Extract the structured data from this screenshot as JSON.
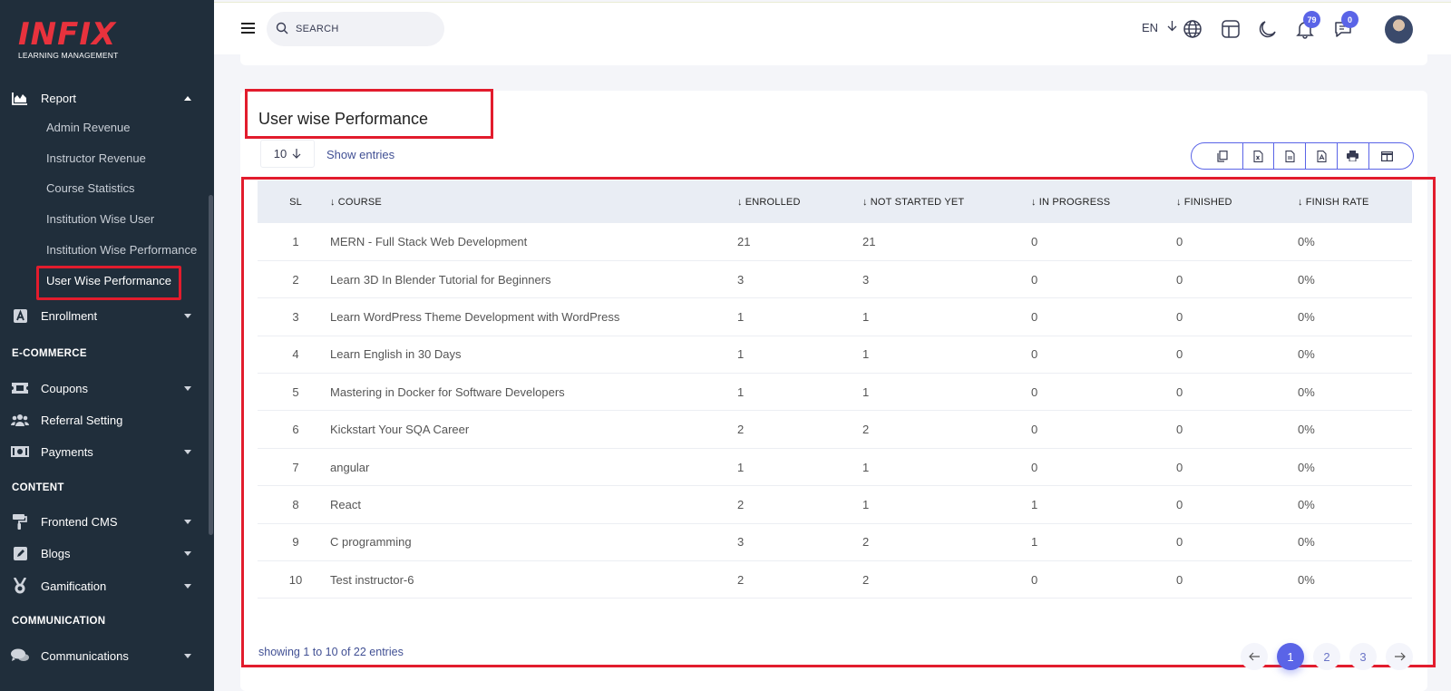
{
  "logo": {
    "brand": "INFIX",
    "subtitle": "LEARNING MANAGEMENT"
  },
  "sidebar": {
    "report": {
      "label": "Report",
      "icon": "chart-area-icon"
    },
    "report_items": [
      "Admin Revenue",
      "Instructor Revenue",
      "Course Statistics",
      "Institution Wise User",
      "Institution Wise Performance",
      "User Wise Performance"
    ],
    "enrollment": {
      "label": "Enrollment",
      "icon": "letter-a-icon"
    },
    "sections": {
      "ecommerce": "E-COMMERCE",
      "content": "CONTENT",
      "communication": "COMMUNICATION"
    },
    "ecommerce_items": [
      {
        "label": "Coupons",
        "icon": "ticket-icon"
      },
      {
        "label": "Referral Setting",
        "icon": "users-icon"
      },
      {
        "label": "Payments",
        "icon": "money-icon"
      }
    ],
    "content_items": [
      {
        "label": "Frontend CMS",
        "icon": "paint-roller-icon"
      },
      {
        "label": "Blogs",
        "icon": "edit-icon"
      },
      {
        "label": "Gamification",
        "icon": "medal-icon"
      }
    ],
    "communication_items": [
      {
        "label": "Communications",
        "icon": "chat-icon"
      }
    ]
  },
  "topbar": {
    "search_placeholder": "SEARCH",
    "language": "EN",
    "notifications_count": "79",
    "messages_count": "0"
  },
  "page": {
    "title": "User wise Performance",
    "entries_value": "10",
    "show_entries_label": "Show entries",
    "showing_text": "showing 1 to 10 of 22 entries"
  },
  "table": {
    "headers": [
      "SL",
      "COURSE",
      "ENROLLED",
      "NOT STARTED YET",
      "IN PROGRESS",
      "FINISHED",
      "FINISH RATE"
    ],
    "rows": [
      [
        "1",
        "MERN - Full Stack Web Development",
        "21",
        "21",
        "0",
        "0",
        "0%"
      ],
      [
        "2",
        "Learn 3D In Blender Tutorial for Beginners",
        "3",
        "3",
        "0",
        "0",
        "0%"
      ],
      [
        "3",
        "Learn WordPress Theme Development with WordPress",
        "1",
        "1",
        "0",
        "0",
        "0%"
      ],
      [
        "4",
        "Learn English in 30 Days",
        "1",
        "1",
        "0",
        "0",
        "0%"
      ],
      [
        "5",
        "Mastering in Docker for Software Developers",
        "1",
        "1",
        "0",
        "0",
        "0%"
      ],
      [
        "6",
        "Kickstart Your SQA Career",
        "2",
        "2",
        "0",
        "0",
        "0%"
      ],
      [
        "7",
        "angular",
        "1",
        "1",
        "0",
        "0",
        "0%"
      ],
      [
        "8",
        "React",
        "2",
        "1",
        "1",
        "0",
        "0%"
      ],
      [
        "9",
        "C programming",
        "3",
        "2",
        "1",
        "0",
        "0%"
      ],
      [
        "10",
        "Test instructor-6",
        "2",
        "2",
        "0",
        "0",
        "0%"
      ]
    ]
  },
  "pagination": {
    "pages": [
      "1",
      "2",
      "3"
    ],
    "active": "1"
  },
  "colors": {
    "sidebar_bg": "#202e3b",
    "accent": "#5a64e7",
    "highlight": "#e21c2d",
    "brand": "#e8323d"
  }
}
